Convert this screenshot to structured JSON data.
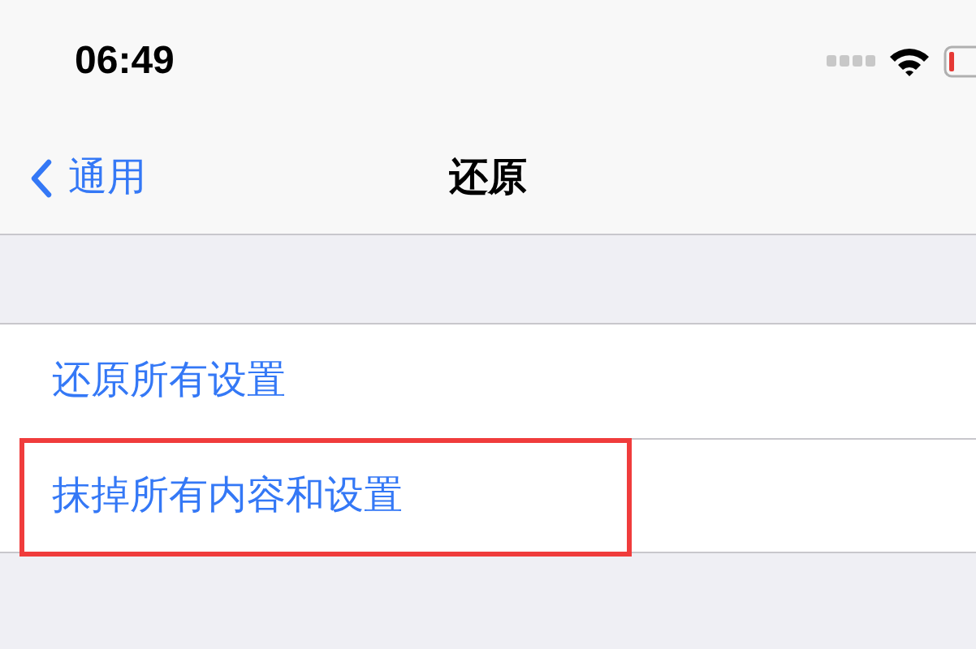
{
  "status_bar": {
    "time": "06:49"
  },
  "nav_bar": {
    "back_label": "通用",
    "title": "还原"
  },
  "items": [
    {
      "label": "还原所有设置",
      "highlighted": false
    },
    {
      "label": "抹掉所有内容和设置",
      "highlighted": true
    }
  ]
}
